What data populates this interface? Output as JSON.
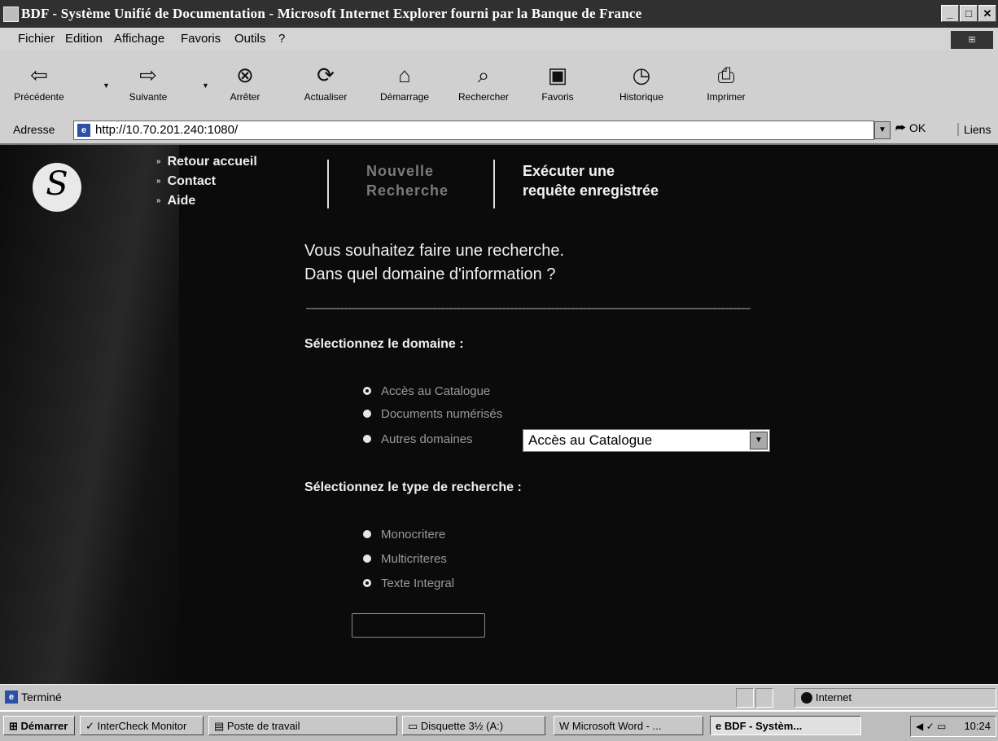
{
  "window": {
    "title": "BDF - Système Unifié de Documentation - Microsoft Internet Explorer fourni par la Banque de France",
    "minimize": "_",
    "maximize": "□",
    "close": "✕"
  },
  "menu": [
    "Fichier",
    "Edition",
    "Affichage",
    "Favoris",
    "Outils",
    "?"
  ],
  "toolbar": [
    {
      "label": "Précédente",
      "icon": "back-arrow-icon"
    },
    {
      "label": "Suivante",
      "icon": "forward-arrow-icon"
    },
    {
      "label": "Arrêter",
      "icon": "stop-icon"
    },
    {
      "label": "Actualiser",
      "icon": "refresh-icon"
    },
    {
      "label": "Démarrage",
      "icon": "home-icon"
    },
    {
      "label": "Rechercher",
      "icon": "search-icon"
    },
    {
      "label": "Favoris",
      "icon": "favorites-icon"
    },
    {
      "label": "Historique",
      "icon": "history-icon"
    },
    {
      "label": "Imprimer",
      "icon": "print-icon"
    }
  ],
  "address": {
    "label": "Adresse",
    "url": "http://10.70.201.240:1080/",
    "go": "OK",
    "links": "Liens"
  },
  "page": {
    "logo_letter": "S",
    "nav_links": [
      "Retour accueil",
      "Contact",
      "Aide"
    ],
    "tab_new_line1": "Nouvelle",
    "tab_new_line2": "Recherche",
    "tab_exec_line1": "Exécuter une",
    "tab_exec_line2": "requête enregistrée",
    "question_line1": "Vous souhaitez faire une recherche.",
    "question_line2": "Dans quel domaine d'information ?",
    "domain_heading": "Sélectionnez le domaine :",
    "domain_options": [
      {
        "label": "Accès au Catalogue",
        "selected": true
      },
      {
        "label": "Documents numérisés",
        "selected": false
      },
      {
        "label": "Autres domaines",
        "selected": false
      }
    ],
    "domain_select_value": "Accès au Catalogue",
    "type_heading": "Sélectionnez le type de recherche :",
    "type_options": [
      {
        "label": "Monocritere",
        "selected": false
      },
      {
        "label": "Multicriteres",
        "selected": false
      },
      {
        "label": "Texte Integral",
        "selected": true
      }
    ],
    "submit_label": ""
  },
  "status": {
    "text": "Terminé",
    "zone": "Internet"
  },
  "taskbar": {
    "start": "Démarrer",
    "tasks": [
      {
        "label": "InterCheck Monitor",
        "active": false
      },
      {
        "label": "Poste de travail",
        "active": false
      },
      {
        "label": "Disquette 3½ (A:)",
        "active": false
      },
      {
        "label": "Microsoft Word - ...",
        "active": false
      },
      {
        "label": "BDF - Systèm...",
        "active": true
      }
    ],
    "clock": "10:24"
  },
  "colors": {
    "page_background": "#0b0b0b",
    "page_text": "#f0f0f0",
    "option_text": "#9a9a9a",
    "chrome": "#d0d0d0"
  }
}
